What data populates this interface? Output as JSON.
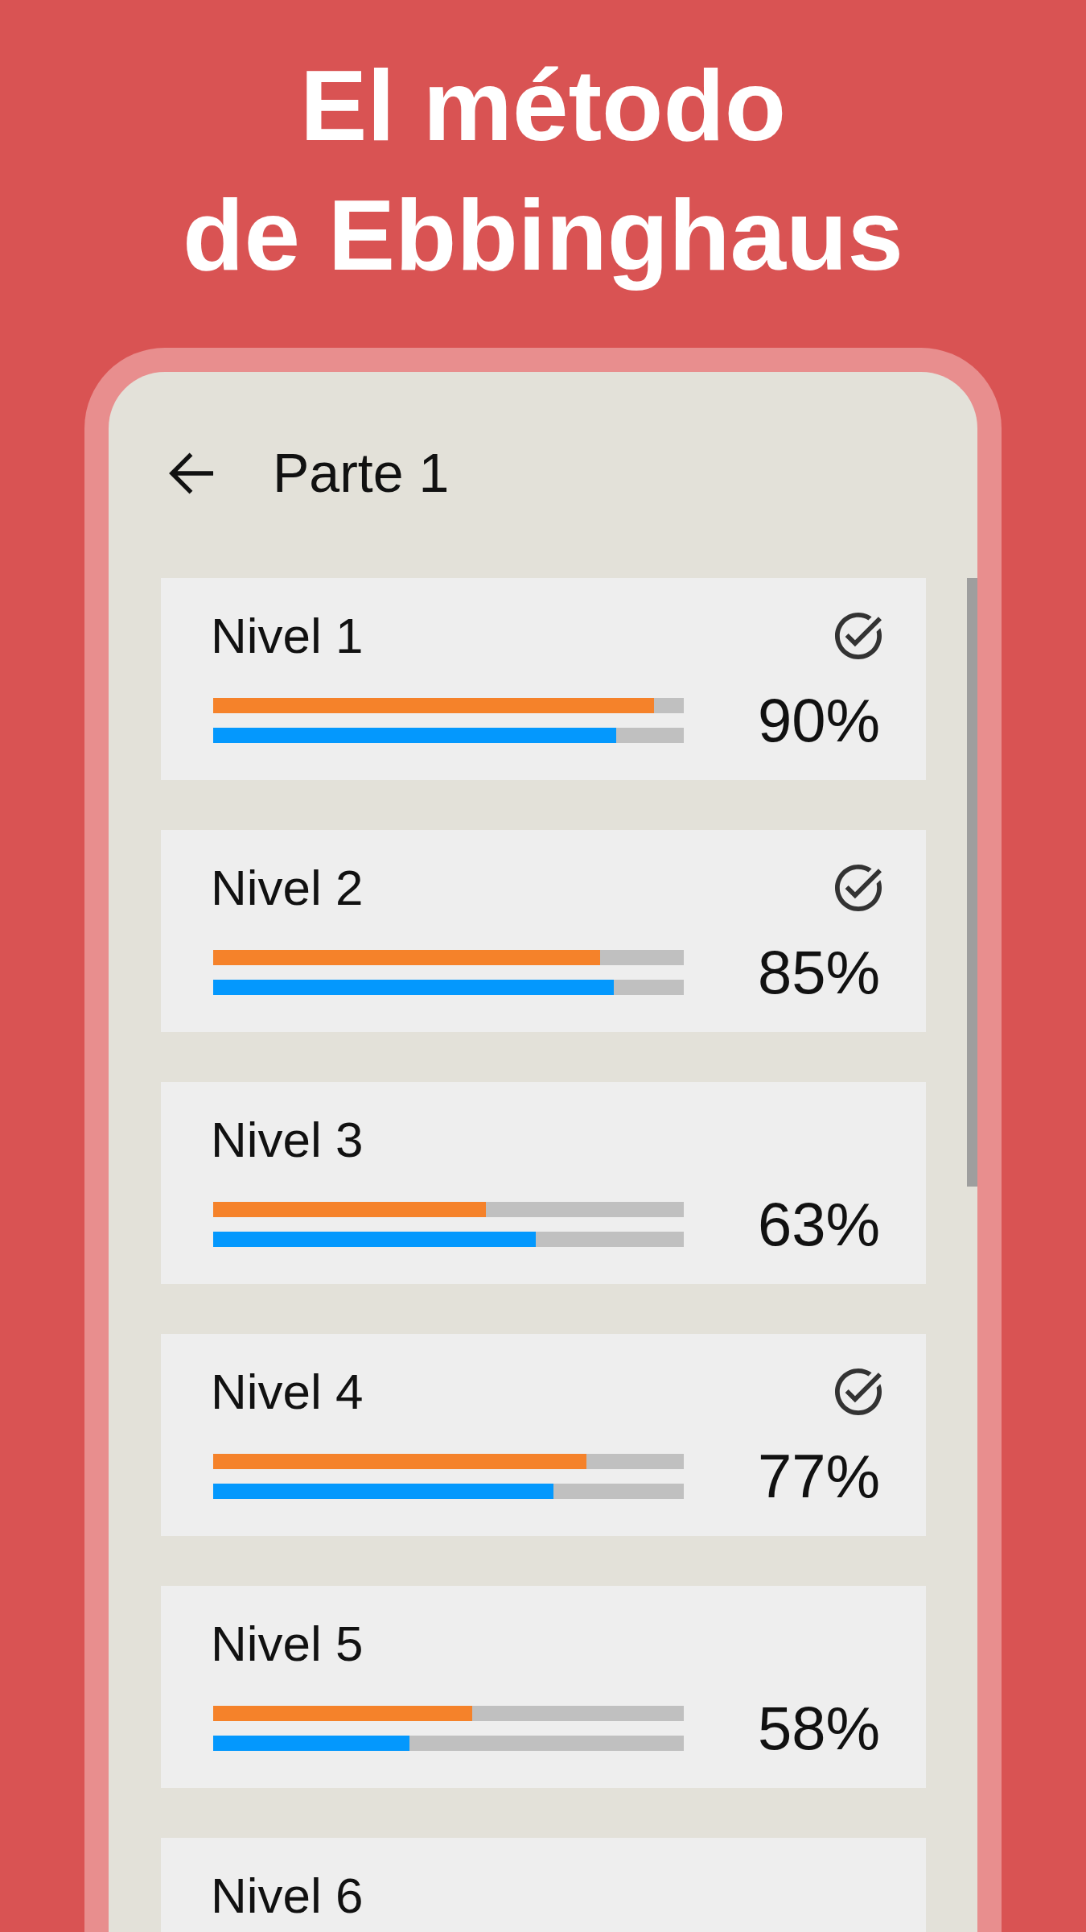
{
  "headline": [
    "El método",
    "de Ebbinghaus"
  ],
  "screen": {
    "title": "Parte 1"
  },
  "levels": [
    {
      "name": "Nivel 1",
      "completed": true,
      "percent": "90%",
      "bars": [
        {
          "color": "#f5822a",
          "level": 0.937
        },
        {
          "color": "#0498fd",
          "level": 0.856
        }
      ]
    },
    {
      "name": "Nivel 2",
      "completed": true,
      "percent": "85%",
      "bars": [
        {
          "color": "#f5822a",
          "level": 0.822
        },
        {
          "color": "#0498fd",
          "level": 0.851
        }
      ]
    },
    {
      "name": "Nivel 3",
      "completed": false,
      "percent": "63%",
      "bars": [
        {
          "color": "#f5822a",
          "level": 0.579
        },
        {
          "color": "#0498fd",
          "level": 0.686
        }
      ]
    },
    {
      "name": "Nivel 4",
      "completed": true,
      "percent": "77%",
      "bars": [
        {
          "color": "#f5822a",
          "level": 0.793
        },
        {
          "color": "#0498fd",
          "level": 0.723
        }
      ]
    },
    {
      "name": "Nivel 5",
      "completed": false,
      "percent": "58%",
      "bars": [
        {
          "color": "#f5822a",
          "level": 0.55
        },
        {
          "color": "#0498fd",
          "level": 0.417
        }
      ]
    },
    {
      "name": "Nivel 6"
    }
  ]
}
